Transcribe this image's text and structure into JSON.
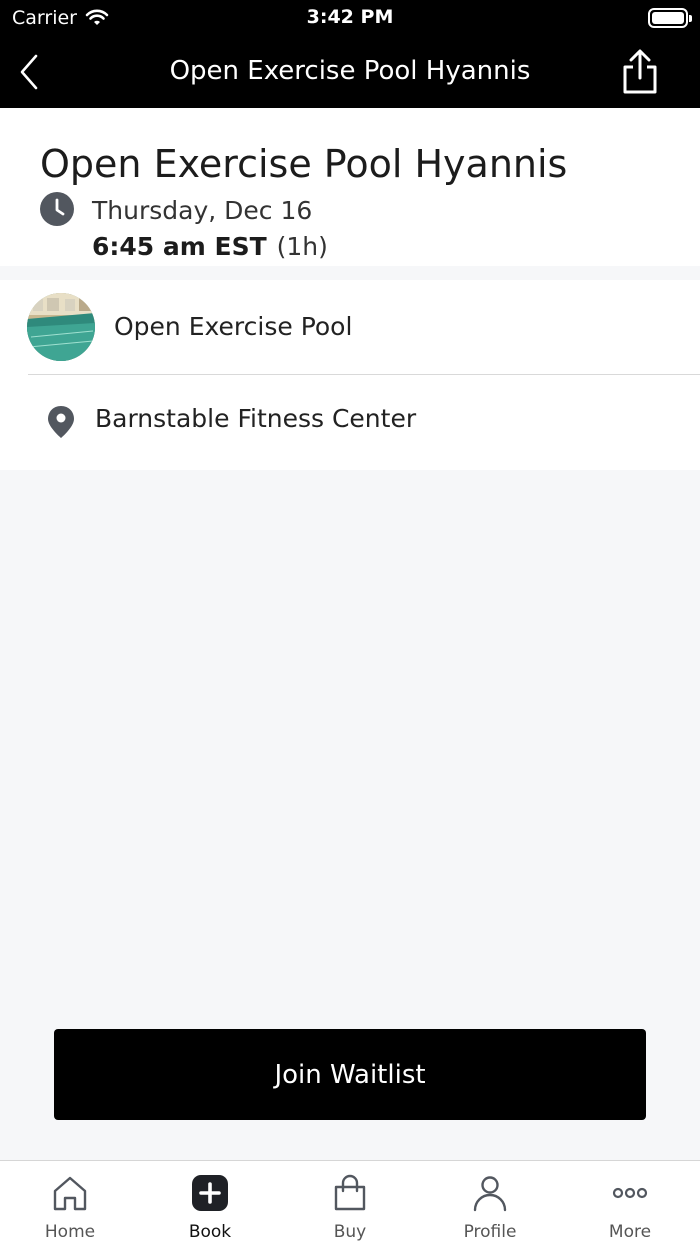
{
  "status_bar": {
    "carrier": "Carrier",
    "time": "3:42 PM"
  },
  "nav": {
    "title": "Open Exercise Pool Hyannis",
    "back_icon": "chevron-left-icon",
    "share_icon": "share-icon"
  },
  "header": {
    "title": "Open Exercise Pool Hyannis",
    "date": "Thursday, Dec 16",
    "time": "6:45 am EST",
    "duration": "(1h)"
  },
  "details": {
    "class_name": "Open Exercise Pool",
    "location": "Barnstable Fitness Center"
  },
  "action": {
    "join_label": "Join Waitlist"
  },
  "tabs": [
    {
      "label": "Home",
      "icon": "home-icon",
      "active": false
    },
    {
      "label": "Book",
      "icon": "plus-square-icon",
      "active": true
    },
    {
      "label": "Buy",
      "icon": "shopping-bag-icon",
      "active": false
    },
    {
      "label": "Profile",
      "icon": "person-icon",
      "active": false
    },
    {
      "label": "More",
      "icon": "more-dots-icon",
      "active": false
    }
  ],
  "colors": {
    "nav_bg": "#000000",
    "button_bg": "#000000",
    "page_bg": "#f6f7f9",
    "icon_gray": "#52575f"
  }
}
